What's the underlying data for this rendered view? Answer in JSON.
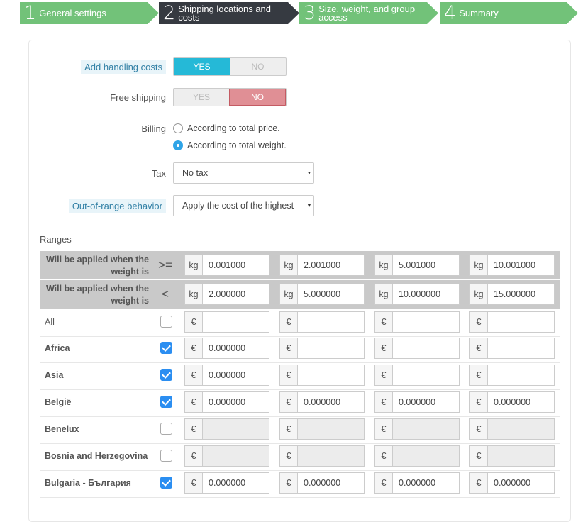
{
  "steps": [
    {
      "num": "1",
      "label": "General settings"
    },
    {
      "num": "2",
      "label": "Shipping locations and costs"
    },
    {
      "num": "3",
      "label": "Size, weight, and group access"
    },
    {
      "num": "4",
      "label": "Summary"
    }
  ],
  "form": {
    "handling": {
      "label": "Add handling costs",
      "yes": "YES",
      "no": "NO",
      "value": "YES"
    },
    "free_shipping": {
      "label": "Free shipping",
      "yes": "YES",
      "no": "NO",
      "value": "NO"
    },
    "billing": {
      "label": "Billing",
      "options": [
        "According to total price.",
        "According to total weight."
      ],
      "selected": "According to total weight."
    },
    "tax": {
      "label": "Tax",
      "value": "No tax"
    },
    "out_of_range": {
      "label": "Out-of-range behavior",
      "value": "Apply the cost of the highest"
    }
  },
  "ranges": {
    "title": "Ranges",
    "row_from": {
      "label": "Will be applied when the weight is",
      "op": ">=",
      "unit": "kg",
      "values": [
        "0.001000",
        "2.001000",
        "5.001000",
        "10.001000"
      ]
    },
    "row_to": {
      "label": "Will be applied when the weight is",
      "op": "<",
      "unit": "kg",
      "values": [
        "2.000000",
        "5.000000",
        "10.000000",
        "15.000000"
      ]
    },
    "currency": "€",
    "zones": [
      {
        "name": "All",
        "checked": false,
        "values": [
          "",
          "",
          "",
          ""
        ],
        "disabled": false,
        "bold": false
      },
      {
        "name": "Africa",
        "checked": true,
        "values": [
          "0.000000",
          "",
          "",
          ""
        ],
        "disabled": false,
        "bold": true
      },
      {
        "name": "Asia",
        "checked": true,
        "values": [
          "0.000000",
          "",
          "",
          ""
        ],
        "disabled": false,
        "bold": true
      },
      {
        "name": "België",
        "checked": true,
        "values": [
          "0.000000",
          "0.000000",
          "0.000000",
          "0.000000"
        ],
        "disabled": false,
        "bold": true
      },
      {
        "name": "Benelux",
        "checked": false,
        "values": [
          "",
          "",
          "",
          ""
        ],
        "disabled": true,
        "bold": true
      },
      {
        "name": "Bosnia and Herzegovina",
        "checked": false,
        "values": [
          "",
          "",
          "",
          ""
        ],
        "disabled": true,
        "bold": true
      },
      {
        "name": "Bulgaria - България",
        "checked": true,
        "values": [
          "0.000000",
          "0.000000",
          "0.000000",
          "0.000000"
        ],
        "disabled": false,
        "bold": true
      }
    ]
  },
  "colors": {
    "step_done": "#72c279",
    "step_active": "#363a41",
    "yes_on": "#25b9d7",
    "no_on": "#e08f95",
    "check": "#2b8ef1"
  }
}
